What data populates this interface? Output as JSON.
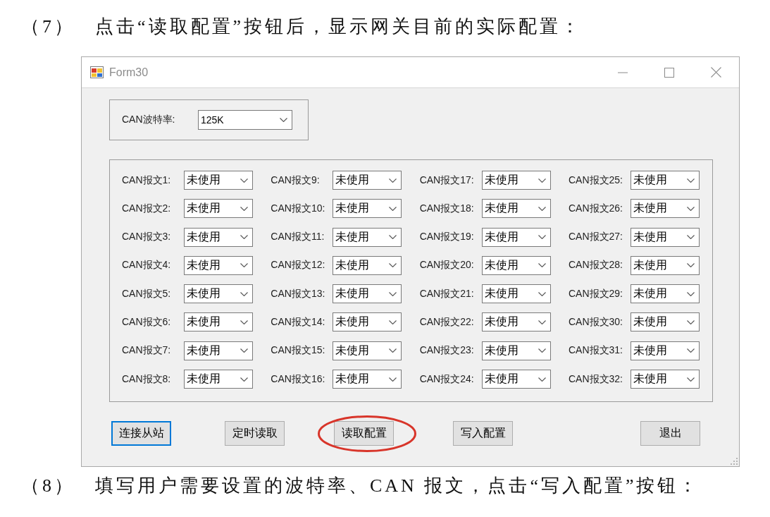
{
  "intro": {
    "number": "（7）",
    "text": "点击“读取配置”按钮后，显示网关目前的实际配置："
  },
  "window": {
    "title": "Form30",
    "baud_rate": {
      "label": "CAN波特率:",
      "value": "125K"
    },
    "message_columns": [
      [
        {
          "label": "CAN报文1:",
          "value": "未使用"
        },
        {
          "label": "CAN报文2:",
          "value": "未使用"
        },
        {
          "label": "CAN报文3:",
          "value": "未使用"
        },
        {
          "label": "CAN报文4:",
          "value": "未使用"
        },
        {
          "label": "CAN报文5:",
          "value": "未使用"
        },
        {
          "label": "CAN报文6:",
          "value": "未使用"
        },
        {
          "label": "CAN报文7:",
          "value": "未使用"
        },
        {
          "label": "CAN报文8:",
          "value": "未使用"
        }
      ],
      [
        {
          "label": "CAN报文9:",
          "value": "未使用"
        },
        {
          "label": "CAN报文10:",
          "value": "未使用"
        },
        {
          "label": "CAN报文11:",
          "value": "未使用"
        },
        {
          "label": "CAN报文12:",
          "value": "未使用"
        },
        {
          "label": "CAN报文13:",
          "value": "未使用"
        },
        {
          "label": "CAN报文14:",
          "value": "未使用"
        },
        {
          "label": "CAN报文15:",
          "value": "未使用"
        },
        {
          "label": "CAN报文16:",
          "value": "未使用"
        }
      ],
      [
        {
          "label": "CAN报文17:",
          "value": "未使用"
        },
        {
          "label": "CAN报文18:",
          "value": "未使用"
        },
        {
          "label": "CAN报文19:",
          "value": "未使用"
        },
        {
          "label": "CAN报文20:",
          "value": "未使用"
        },
        {
          "label": "CAN报文21:",
          "value": "未使用"
        },
        {
          "label": "CAN报文22:",
          "value": "未使用"
        },
        {
          "label": "CAN报文23:",
          "value": "未使用"
        },
        {
          "label": "CAN报文24:",
          "value": "未使用"
        }
      ],
      [
        {
          "label": "CAN报文25:",
          "value": "未使用"
        },
        {
          "label": "CAN报文26:",
          "value": "未使用"
        },
        {
          "label": "CAN报文27:",
          "value": "未使用"
        },
        {
          "label": "CAN报文28:",
          "value": "未使用"
        },
        {
          "label": "CAN报文29:",
          "value": "未使用"
        },
        {
          "label": "CAN报文30:",
          "value": "未使用"
        },
        {
          "label": "CAN报文31:",
          "value": "未使用"
        },
        {
          "label": "CAN报文32:",
          "value": "未使用"
        }
      ]
    ],
    "buttons": [
      {
        "label": "连接从站",
        "focused": true,
        "highlighted": false
      },
      {
        "label": "定时读取",
        "focused": false,
        "highlighted": false
      },
      {
        "label": "读取配置",
        "focused": false,
        "highlighted": true
      },
      {
        "label": "写入配置",
        "focused": false,
        "highlighted": false
      },
      {
        "label": "退出",
        "focused": false,
        "highlighted": false
      }
    ]
  },
  "next_step": {
    "number": "（8）",
    "text": "填写用户需要设置的波特率、CAN 报文，点击“写入配置”按钮："
  }
}
